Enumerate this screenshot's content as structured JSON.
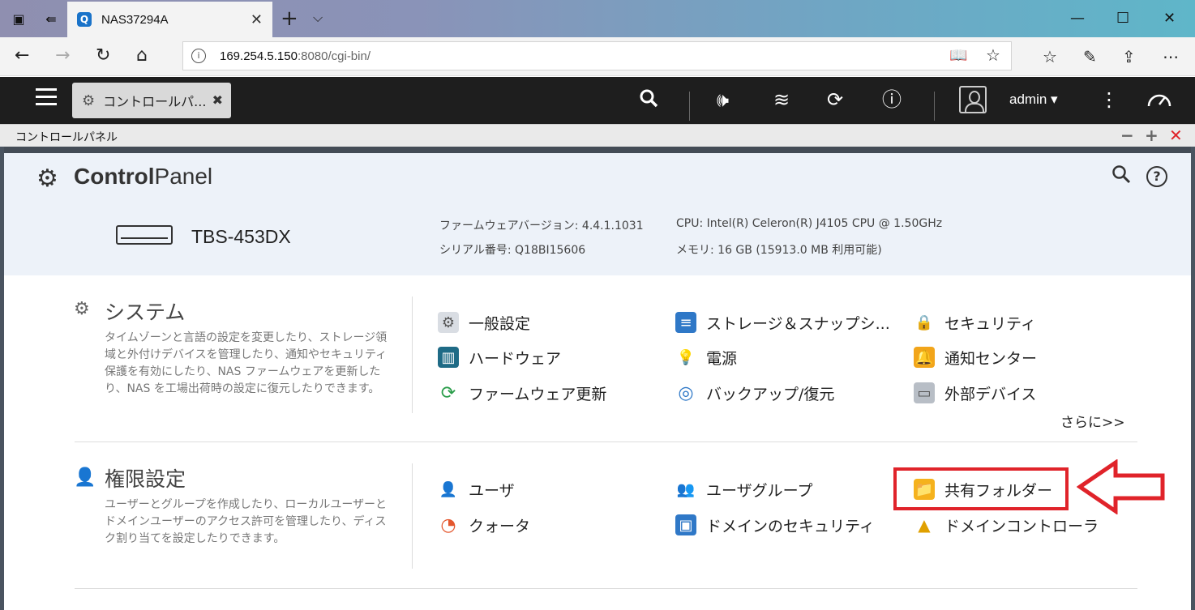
{
  "browser": {
    "tab_title": "NAS37294A",
    "url_host": "169.254.5.150",
    "url_rest": ":8080/cgi-bin/"
  },
  "qts": {
    "app_tab": "コントロールパ...",
    "user": "admin"
  },
  "window": {
    "title": "コントロールパネル"
  },
  "control_panel": {
    "title_bold": "Control",
    "title_rest": "Panel",
    "model": "TBS-453DX",
    "firmware": "ファームウェアバージョン: 4.4.1.1031",
    "serial": "シリアル番号: Q18BI15606",
    "cpu": "CPU: Intel(R) Celeron(R) J4105 CPU @ 1.50GHz",
    "memory": "メモリ: 16 GB (15913.0 MB 利用可能)"
  },
  "system": {
    "title": "システム",
    "desc": "タイムゾーンと言語の設定を変更したり、ストレージ領域と外付けデバイスを管理したり、通知やセキュリティ保護を有効にしたり、NAS ファームウェアを更新したり、NAS を工場出荷時の設定に復元したりできます。",
    "items": [
      {
        "label": "一般設定",
        "icon": "general-settings-icon"
      },
      {
        "label": "ストレージ＆スナップシ...",
        "icon": "storage-icon"
      },
      {
        "label": "セキュリティ",
        "icon": "lock-icon"
      },
      {
        "label": "ハードウェア",
        "icon": "hardware-icon"
      },
      {
        "label": "電源",
        "icon": "power-bulb-icon"
      },
      {
        "label": "通知センター",
        "icon": "notification-icon"
      },
      {
        "label": "ファームウェア更新",
        "icon": "firmware-update-icon"
      },
      {
        "label": "バックアップ/復元",
        "icon": "backup-icon"
      },
      {
        "label": "外部デバイス",
        "icon": "external-device-icon"
      }
    ],
    "more": "さらに>>"
  },
  "privilege": {
    "title": "権限設定",
    "desc": "ユーザーとグループを作成したり、ローカルユーザーとドメインユーザーのアクセス許可を管理したり、ディスク割り当てを設定したりできます。",
    "items": [
      {
        "label": "ユーザ",
        "icon": "user-icon"
      },
      {
        "label": "ユーザグループ",
        "icon": "user-group-icon"
      },
      {
        "label": "共有フォルダー",
        "icon": "shared-folder-icon"
      },
      {
        "label": "クォータ",
        "icon": "quota-icon"
      },
      {
        "label": "ドメインのセキュリティ",
        "icon": "domain-security-icon"
      },
      {
        "label": "ドメインコントローラ",
        "icon": "domain-controller-icon"
      }
    ]
  },
  "colors": {
    "highlight": "#e0232a",
    "qts_bar": "#1e1e1e",
    "cp_header": "#edf2f9"
  }
}
